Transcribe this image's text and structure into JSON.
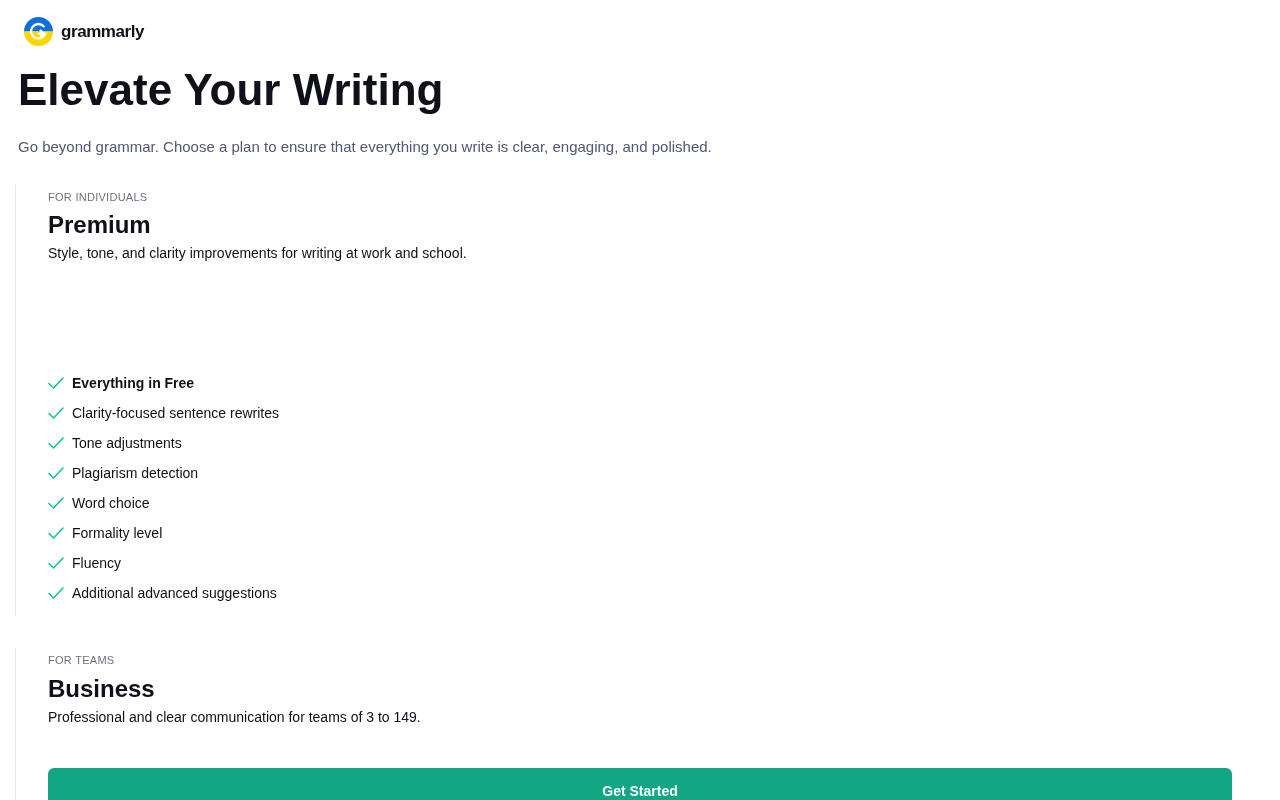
{
  "brand": {
    "name": "grammarly"
  },
  "hero": {
    "title": "Elevate Your Writing",
    "subtitle": "Go beyond grammar. Choose a plan to ensure that everything you write is clear, engaging, and polished."
  },
  "plans": [
    {
      "eyebrow": "FOR INDIVIDUALS",
      "name": "Premium",
      "description": "Style, tone, and clarity improvements for writing at work and school.",
      "features": [
        {
          "label": "Everything in Free",
          "bold": true
        },
        {
          "label": "Clarity-focused sentence rewrites",
          "bold": false
        },
        {
          "label": "Tone adjustments",
          "bold": false
        },
        {
          "label": "Plagiarism detection",
          "bold": false
        },
        {
          "label": "Word choice",
          "bold": false
        },
        {
          "label": "Formality level",
          "bold": false
        },
        {
          "label": "Fluency",
          "bold": false
        },
        {
          "label": "Additional advanced suggestions",
          "bold": false
        }
      ]
    },
    {
      "eyebrow": "FOR TEAMS",
      "name": "Business",
      "description": "Professional and clear communication for teams of 3 to 149.",
      "cta": "Get Started"
    }
  ]
}
